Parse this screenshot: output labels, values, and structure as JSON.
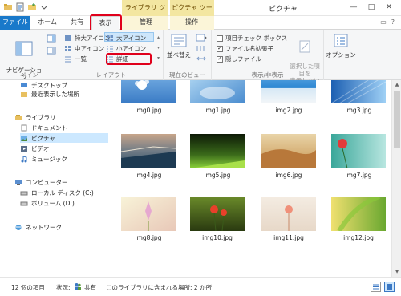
{
  "window": {
    "title": "ピクチャ"
  },
  "context_tabs": {
    "library_tools": "ライブラリ ツール",
    "picture_tools": "ピクチャ ツール"
  },
  "tabs": {
    "file": "ファイル",
    "home": "ホーム",
    "share": "共有",
    "view": "表示",
    "manage": "管理",
    "operate": "操作"
  },
  "ribbon": {
    "pane_group": {
      "nav_pane_label": "ナビゲーション\nウィンドウ ▾",
      "group_label": "ペイン"
    },
    "layout_group": {
      "items": [
        "特大アイコン",
        "中アイコン",
        "一覧",
        "大アイコン",
        "小アイコン",
        "詳細"
      ],
      "group_label": "レイアウト"
    },
    "current_view_group": {
      "sort_label": "並べ替え",
      "group_label": "現在のビュー"
    },
    "show_hide_group": {
      "checkbox_item": "項目チェック ボックス",
      "file_ext": "ファイル名拡張子",
      "hidden_files": "隠しファイル",
      "hide_selected": "選択した項目を\n表示しない",
      "group_label": "表示/非表示"
    },
    "options_label": "オプション"
  },
  "nav": {
    "desktop": "デスクトップ",
    "recent": "最近表示した場所",
    "libraries": "ライブラリ",
    "documents": "ドキュメント",
    "pictures": "ピクチャ",
    "videos": "ビデオ",
    "music": "ミュージック",
    "computer": "コンピューター",
    "local_disk": "ローカル ディスク (C:)",
    "volume_d": "ボリューム (D:)",
    "network": "ネットワーク"
  },
  "files": [
    "img0.jpg",
    "img1.jpg",
    "img2.jpg",
    "img3.jpg",
    "img4.jpg",
    "img5.jpg",
    "img6.jpg",
    "img7.jpg",
    "img8.jpg",
    "img10.jpg",
    "img11.jpg",
    "img12.jpg"
  ],
  "status": {
    "count": "12 個の項目",
    "state_label": "状況:",
    "state_value": "共有",
    "locations": "このライブラリに含まれる場所: 2 か所"
  },
  "colors": {
    "file_tab": "#1979ca",
    "context_band": "#f3e6a1",
    "highlight": "#e0001b",
    "selected": "#cde6fb"
  }
}
